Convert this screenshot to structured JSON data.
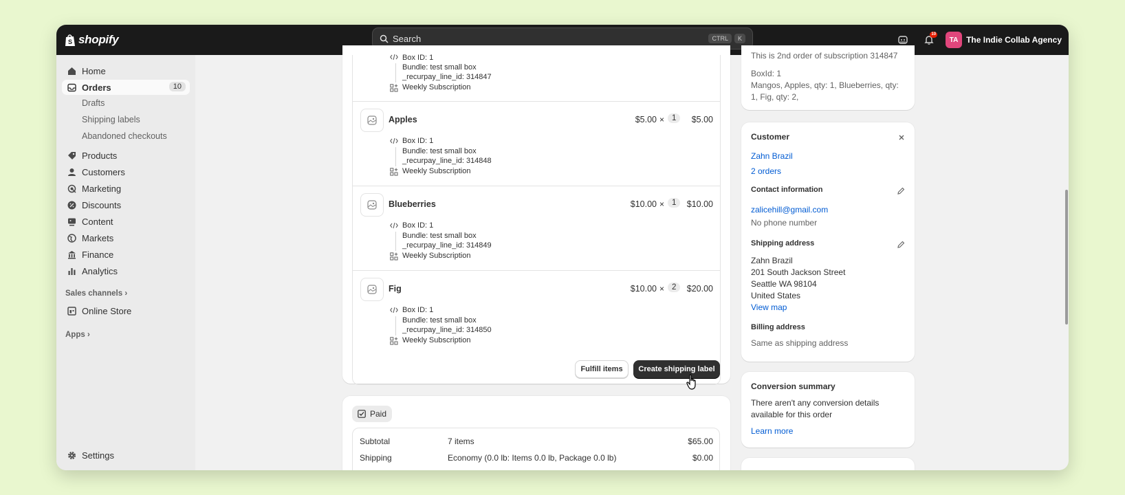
{
  "app": {
    "logo_text": "shopify",
    "search_placeholder": "Search",
    "search_shortcut_1": "CTRL",
    "search_shortcut_2": "K",
    "notification_count": "10",
    "avatar_initials": "TA",
    "store_name": "The Indie Collab Agency"
  },
  "sidebar": {
    "home": "Home",
    "orders": "Orders",
    "orders_count": "10",
    "drafts": "Drafts",
    "shipping_labels": "Shipping labels",
    "abandoned_checkouts": "Abandoned checkouts",
    "products": "Products",
    "customers": "Customers",
    "marketing": "Marketing",
    "discounts": "Discounts",
    "content": "Content",
    "markets": "Markets",
    "finance": "Finance",
    "analytics": "Analytics",
    "sales_channels": "Sales channels",
    "online_store": "Online Store",
    "apps": "Apps",
    "settings": "Settings"
  },
  "line_items": {
    "top_partial": {
      "box_id": "Box ID: 1",
      "bundle": "Bundle: test small box",
      "recurpay": "_recurpay_line_id: 314847",
      "subscription": "Weekly Subscription"
    },
    "items": [
      {
        "name": "Apples",
        "price": "$5.00",
        "times": "×",
        "qty": "1",
        "total": "$5.00",
        "box_id": "Box ID: 1",
        "bundle": "Bundle: test small box",
        "recurpay": "_recurpay_line_id: 314848",
        "subscription": "Weekly Subscription"
      },
      {
        "name": "Blueberries",
        "price": "$10.00",
        "times": "×",
        "qty": "1",
        "total": "$10.00",
        "box_id": "Box ID: 1",
        "bundle": "Bundle: test small box",
        "recurpay": "_recurpay_line_id: 314849",
        "subscription": "Weekly Subscription"
      },
      {
        "name": "Fig",
        "price": "$10.00",
        "times": "×",
        "qty": "2",
        "total": "$20.00",
        "box_id": "Box ID: 1",
        "bundle": "Bundle: test small box",
        "recurpay": "_recurpay_line_id: 314850",
        "subscription": "Weekly Subscription"
      }
    ],
    "fulfill_button": "Fulfill items",
    "create_label_button": "Create shipping label"
  },
  "payment": {
    "status": "Paid",
    "rows": [
      {
        "label": "Subtotal",
        "desc": "7 items",
        "amount": "$65.00"
      },
      {
        "label": "Shipping",
        "desc": "Economy (0.0 lb: Items 0.0 lb, Package 0.0 lb)",
        "amount": "$0.00"
      }
    ]
  },
  "notes": {
    "line1": "This is 2nd order of subscription 314847",
    "line2": "BoxId: 1",
    "line3": "Mangos, Apples, qty: 1, Blueberries, qty:",
    "line4": "1, Fig, qty: 2,"
  },
  "customer": {
    "title": "Customer",
    "name": "Zahn Brazil",
    "orders": "2 orders",
    "contact_title": "Contact information",
    "email": "zalicehill@gmail.com",
    "phone": "No phone number",
    "shipping_title": "Shipping address",
    "ship_name": "Zahn Brazil",
    "ship_street": "201 South Jackson Street",
    "ship_city": "Seattle WA 98104",
    "ship_country": "United States",
    "view_map": "View map",
    "billing_title": "Billing address",
    "billing_value": "Same as shipping address"
  },
  "conversion": {
    "title": "Conversion summary",
    "text1": "There aren't any conversion details",
    "text2": "available for this order",
    "learn_more": "Learn more"
  }
}
